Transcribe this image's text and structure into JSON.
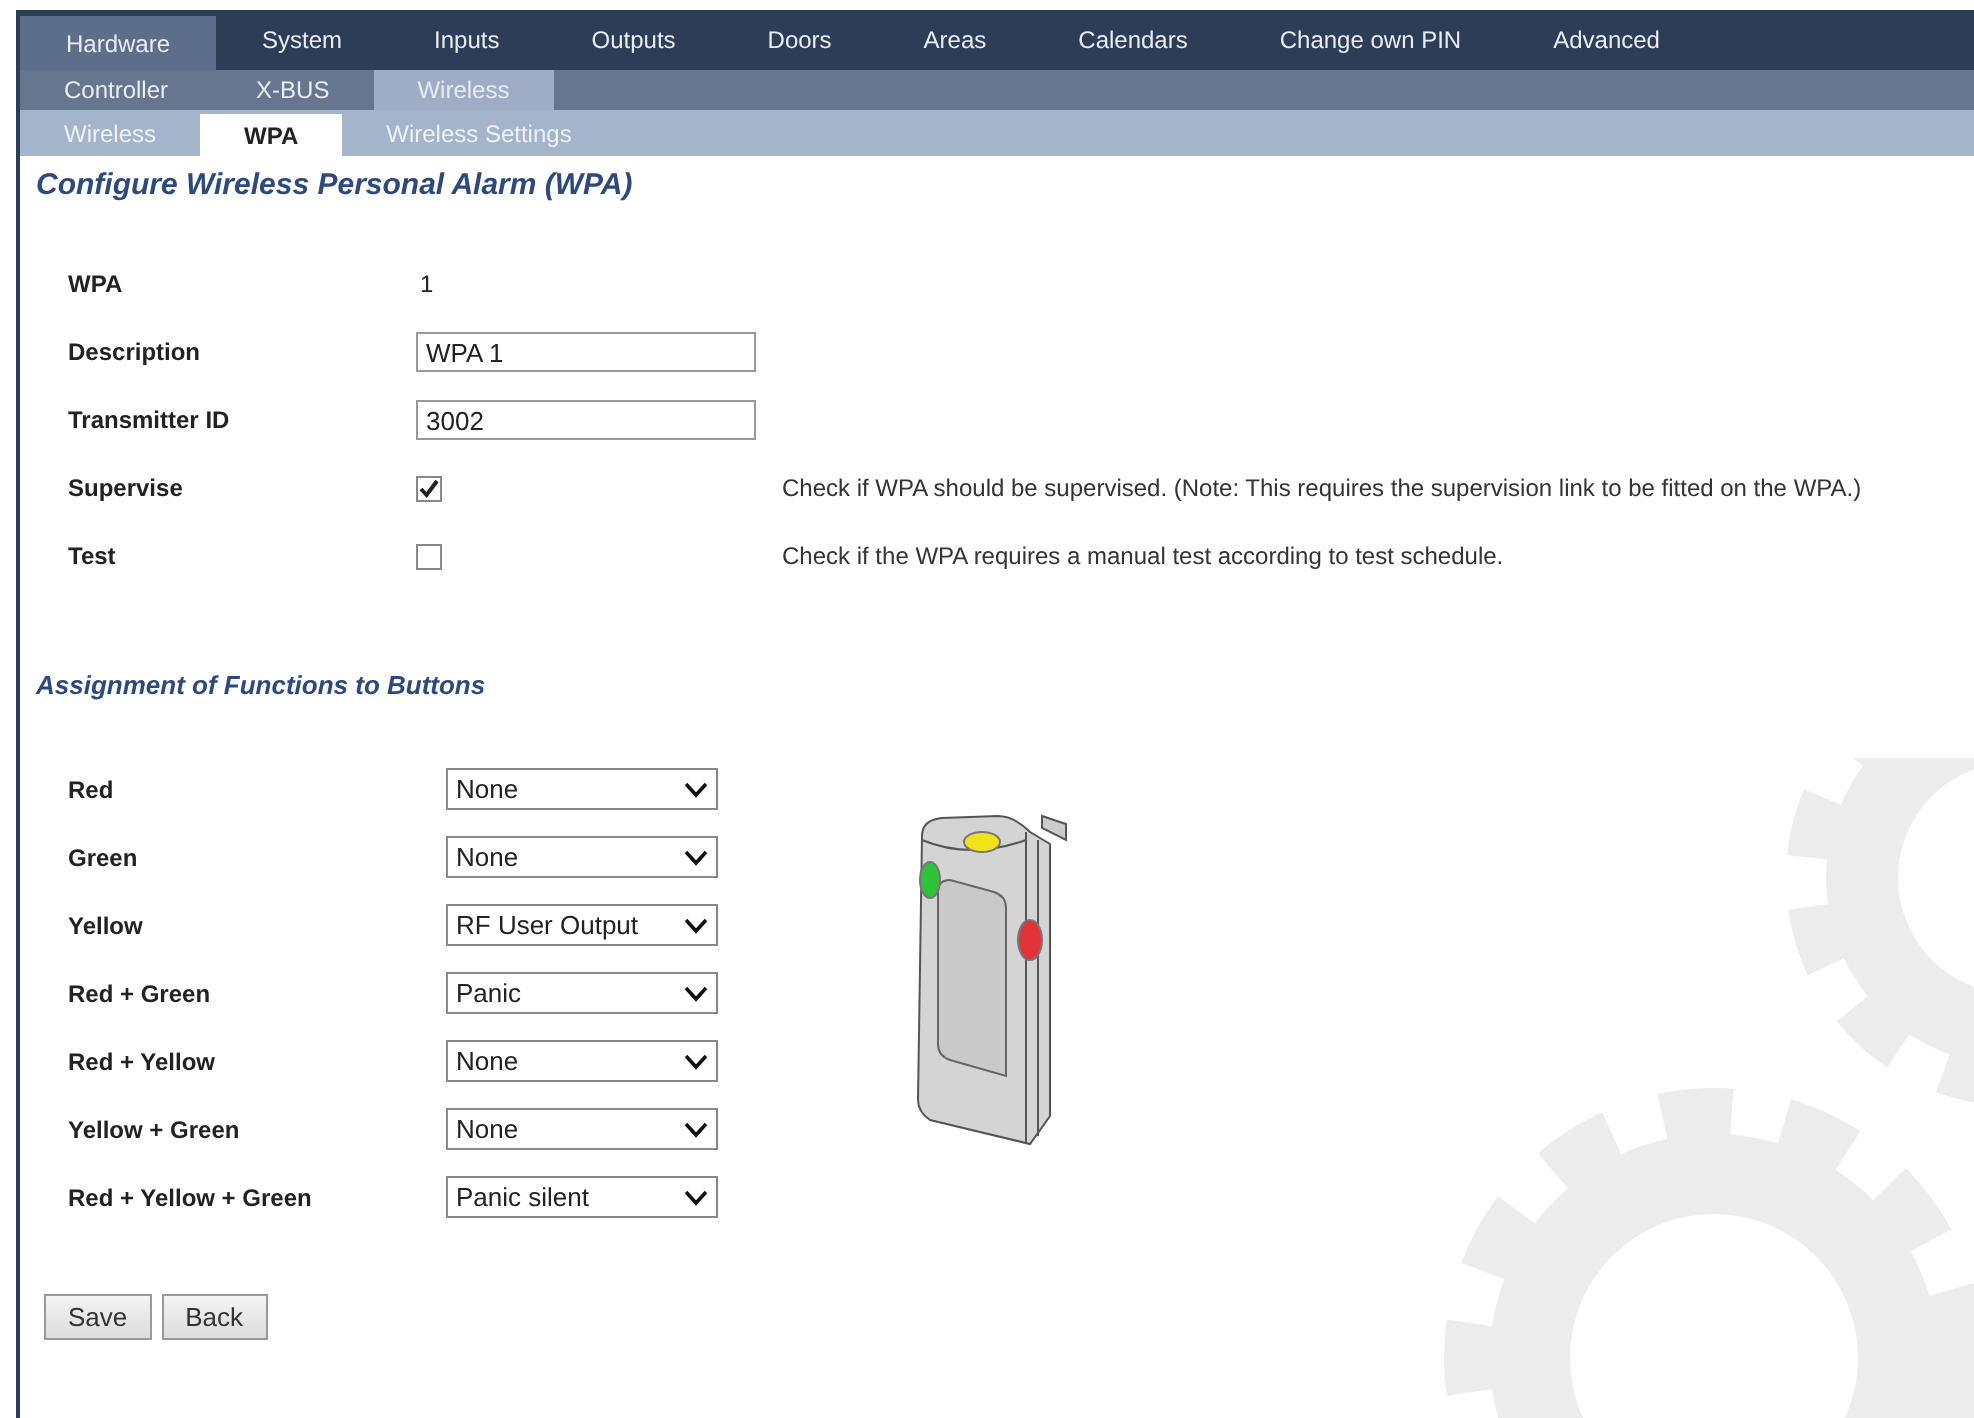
{
  "nav": {
    "main_tabs": [
      {
        "label": "Hardware",
        "selected": true
      },
      {
        "label": "System",
        "selected": false
      },
      {
        "label": "Inputs",
        "selected": false
      },
      {
        "label": "Outputs",
        "selected": false
      },
      {
        "label": "Doors",
        "selected": false
      },
      {
        "label": "Areas",
        "selected": false
      },
      {
        "label": "Calendars",
        "selected": false
      },
      {
        "label": "Change own PIN",
        "selected": false
      },
      {
        "label": "Advanced",
        "selected": false
      }
    ],
    "sub_tabs": [
      {
        "label": "Controller",
        "selected": false
      },
      {
        "label": "X-BUS",
        "selected": false
      },
      {
        "label": "Wireless",
        "selected": true
      }
    ],
    "page_tabs": [
      {
        "label": "Wireless",
        "selected": false
      },
      {
        "label": "WPA",
        "selected": true
      },
      {
        "label": "Wireless Settings",
        "selected": false
      }
    ]
  },
  "page_title": "Configure Wireless Personal Alarm (WPA)",
  "fields": [
    {
      "kind": "text",
      "label": "WPA",
      "value": "1"
    },
    {
      "kind": "input",
      "label": "Description",
      "value": "WPA 1"
    },
    {
      "kind": "input",
      "label": "Transmitter ID",
      "value": "3002"
    },
    {
      "kind": "checkbox",
      "label": "Supervise",
      "checked": true,
      "help": "Check if WPA should be supervised. (Note: This requires the supervision link to be fitted on the WPA.)"
    },
    {
      "kind": "checkbox",
      "label": "Test",
      "checked": false,
      "help": "Check if the WPA requires a manual test according to test schedule."
    }
  ],
  "section_title": "Assignment of Functions to Buttons",
  "button_functions": [
    {
      "label": "Red",
      "value": "None"
    },
    {
      "label": "Green",
      "value": "None"
    },
    {
      "label": "Yellow",
      "value": "RF User Output"
    },
    {
      "label": "Red + Green",
      "value": "Panic"
    },
    {
      "label": "Red + Yellow",
      "value": "None"
    },
    {
      "label": "Yellow + Green",
      "value": "None"
    },
    {
      "label": "Red + Yellow + Green",
      "value": "Panic silent"
    }
  ],
  "actions": [
    "Save",
    "Back"
  ]
}
